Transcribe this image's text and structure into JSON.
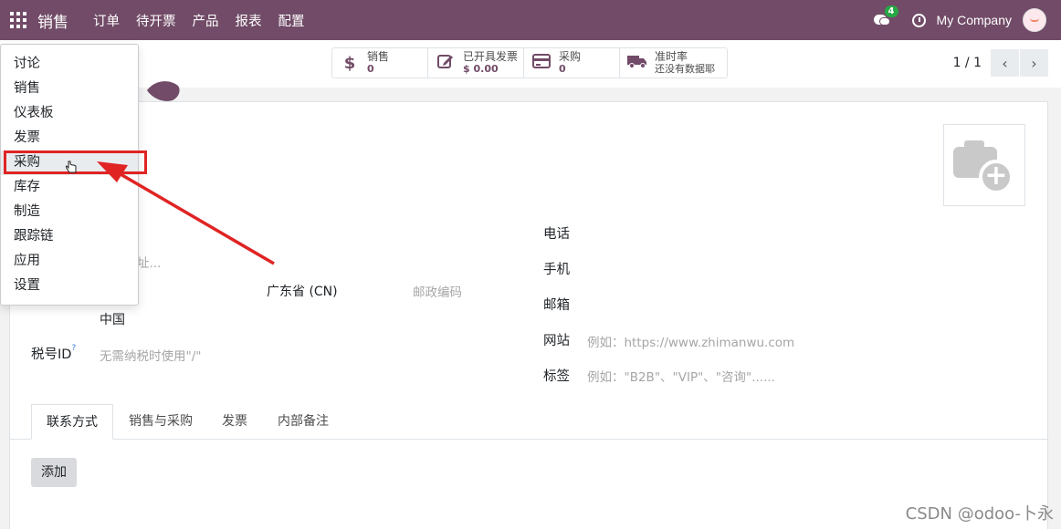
{
  "navbar": {
    "brand": "销售",
    "menu": [
      "订单",
      "待开票",
      "产品",
      "报表",
      "配置"
    ],
    "notification_count": "4",
    "company": "My Company"
  },
  "smart_buttons": [
    {
      "icon": "dollar-icon",
      "label": "销售",
      "value": "0"
    },
    {
      "icon": "edit-invoice-icon",
      "label": "已开具发票",
      "value": "$ 0.00"
    },
    {
      "icon": "credit-card-icon",
      "label": "采购",
      "value": "0"
    },
    {
      "icon": "truck-icon",
      "label": "准时率",
      "value": "还没有数据耶"
    }
  ],
  "pager": {
    "text": "1 / 1",
    "prev": "‹",
    "next": "›"
  },
  "apps_menu": {
    "items": [
      "讨论",
      "销售",
      "仪表板",
      "发票",
      "采购",
      "库存",
      "制造",
      "跟踪链",
      "应用",
      "设置"
    ],
    "highlighted_index": 4
  },
  "form": {
    "address_placeholder_fragment": "址...",
    "state": "广东省 (CN)",
    "zip_placeholder": "邮政编码",
    "country": "中国",
    "tax_label": "税号ID",
    "tax_help": "?",
    "tax_placeholder": "无需纳税时使用\"/\"",
    "phone_label": "电话",
    "mobile_label": "手机",
    "email_label": "邮箱",
    "website_label": "网站",
    "website_placeholder": "例如：https://www.zhimanwu.com",
    "tags_label": "标签",
    "tags_placeholder": "例如：\"B2B\"、\"VIP\"、\"咨询\"......"
  },
  "tabs": [
    "联系方式",
    "销售与采购",
    "发票",
    "内部备注"
  ],
  "add_button": "添加",
  "watermark": "CSDN @odoo-卜永",
  "colors": {
    "brand": "#714B67",
    "annotation": "#e02424"
  }
}
